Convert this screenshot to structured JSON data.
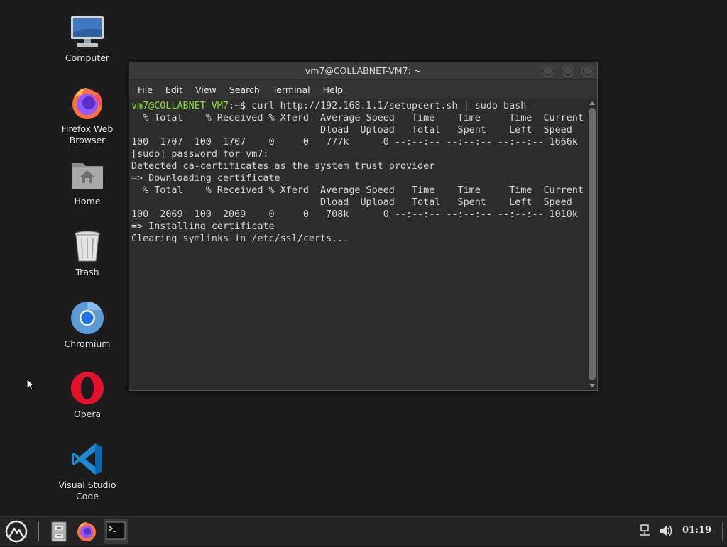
{
  "desktop": {
    "icons": [
      {
        "label": "Computer"
      },
      {
        "label": "Firefox Web Browser"
      },
      {
        "label": "Home"
      },
      {
        "label": "Trash"
      },
      {
        "label": "Chromium"
      },
      {
        "label": "Opera"
      },
      {
        "label": "Visual Studio Code"
      }
    ]
  },
  "window": {
    "title": "vm7@COLLABNET-VM7: ~",
    "menu": [
      "File",
      "Edit",
      "View",
      "Search",
      "Terminal",
      "Help"
    ],
    "prompt_user": "vm7@COLLABNET-VM7",
    "prompt_rest": ":~$ curl http://192.168.1.1/setupcert.sh | sudo bash -",
    "lines": [
      "  % Total    % Received % Xferd  Average Speed   Time    Time     Time  Current",
      "                                 Dload  Upload   Total   Spent    Left  Speed",
      "100  1707  100  1707    0     0   777k      0 --:--:-- --:--:-- --:--:-- 1666k",
      "[sudo] password for vm7:",
      "Detected ca-certificates as the system trust provider",
      "=> Downloading certificate",
      "  % Total    % Received % Xferd  Average Speed   Time    Time     Time  Current",
      "                                 Dload  Upload   Total   Spent    Left  Speed",
      "100  2069  100  2069    0     0   708k      0 --:--:-- --:--:-- --:--:-- 1010k",
      "=> Installing certificate",
      "Clearing symlinks in /etc/ssl/certs..."
    ]
  },
  "taskbar": {
    "clock": "01:19"
  }
}
